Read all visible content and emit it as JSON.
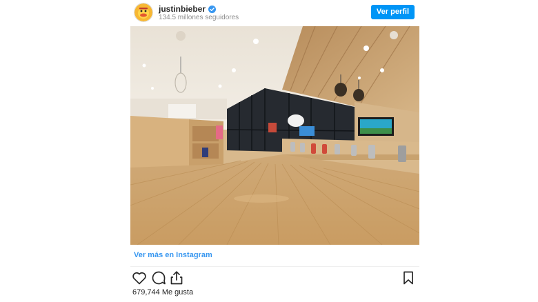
{
  "post": {
    "username": "justinbieber",
    "verified": true,
    "followers": "134.5 millones seguidores",
    "profile_button": "Ver perfil",
    "avatar_icon": "cartoon-duck-avatar-icon",
    "photo": "interior-room-wood-floor-photo",
    "more_link": "Ver más en Instagram",
    "likes": "679,744 Me gusta",
    "action_icons": [
      "heart-icon",
      "comment-icon",
      "share-icon",
      "bookmark-icon"
    ],
    "colors": {
      "accent": "#0095f6",
      "link": "#3897f0",
      "muted": "#8e8e8e",
      "text": "#262626"
    }
  }
}
